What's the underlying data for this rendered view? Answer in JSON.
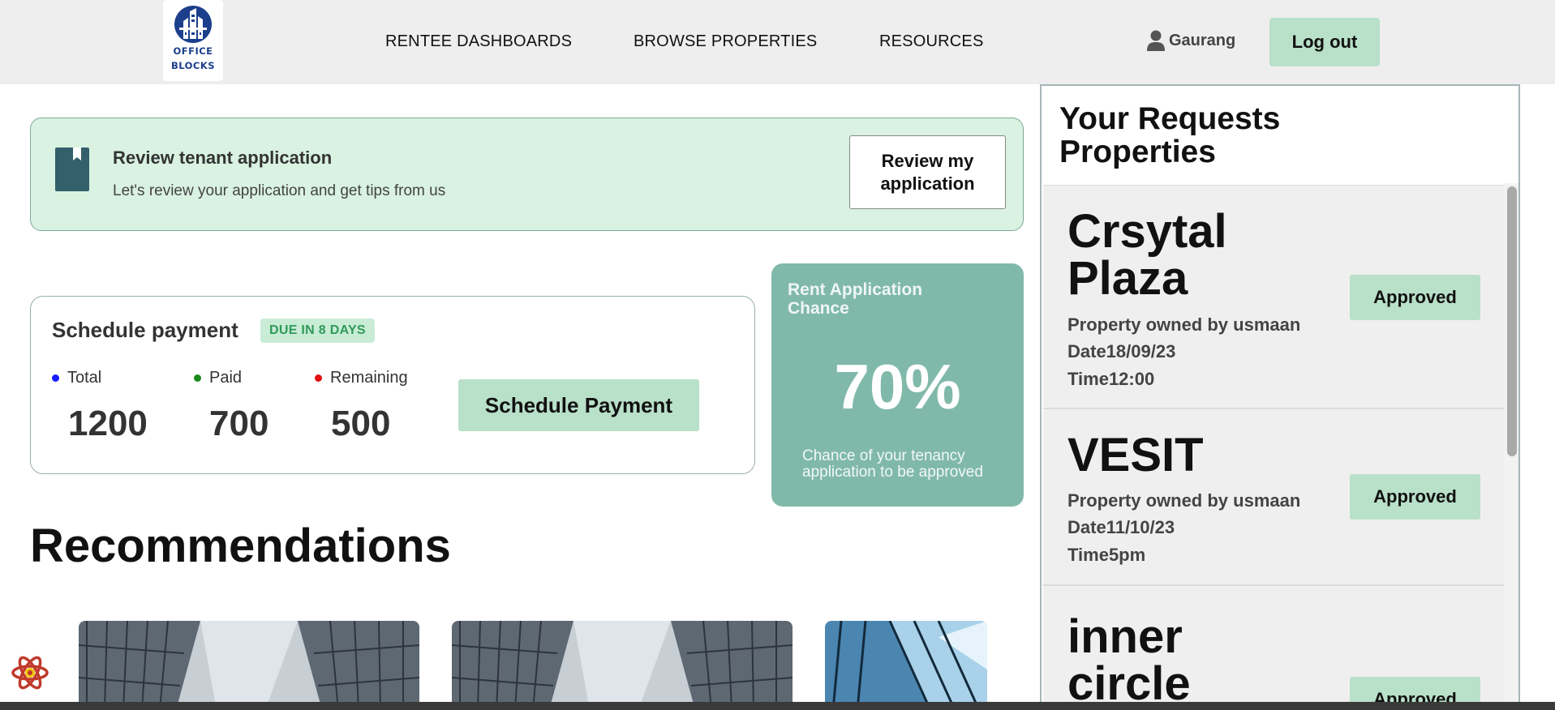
{
  "header": {
    "logo_line1": "OFFICE",
    "logo_line2": "BLOCKS",
    "nav": [
      "RENTEE DASHBOARDS",
      "BROWSE PROPERTIES",
      "RESOURCES"
    ],
    "user_name": "Gaurang",
    "logout_label": "Log out"
  },
  "banner": {
    "title": "Review tenant application",
    "subtitle": "Let's review your application and get tips from us",
    "button_label": "Review my application"
  },
  "payment": {
    "title": "Schedule payment",
    "due_badge": "DUE IN 8 DAYS",
    "stats": [
      {
        "label": "Total",
        "value": "1200",
        "color": "#1a1aff"
      },
      {
        "label": "Paid",
        "value": "700",
        "color": "#1a8a1a"
      },
      {
        "label": "Remaining",
        "value": "500",
        "color": "#e01010"
      }
    ],
    "button_label": "Schedule Payment"
  },
  "chance": {
    "title": "Rent Application Chance",
    "value": "70%",
    "subtitle": "Chance of your tenancy application to be approved"
  },
  "recommendations": {
    "title": "Recommendations"
  },
  "requests": {
    "title": "Your Requests Properties",
    "items": [
      {
        "name": "Crsytal Plaza",
        "owner": "Property owned by usmaan",
        "date": "Date18/09/23",
        "time": "Time12:00",
        "status": "Approved"
      },
      {
        "name": "VESIT",
        "owner": "Property owned by usmaan",
        "date": "Date11/10/23",
        "time": "Time5pm",
        "status": "Approved"
      },
      {
        "name": "inner circle",
        "status": "Approved"
      }
    ]
  },
  "colors": {
    "accent_green": "#b9e0c9",
    "banner_bg": "#d9f2e1",
    "chance_bg": "#80b9aa",
    "logo_blue": "#1c3f8c"
  }
}
